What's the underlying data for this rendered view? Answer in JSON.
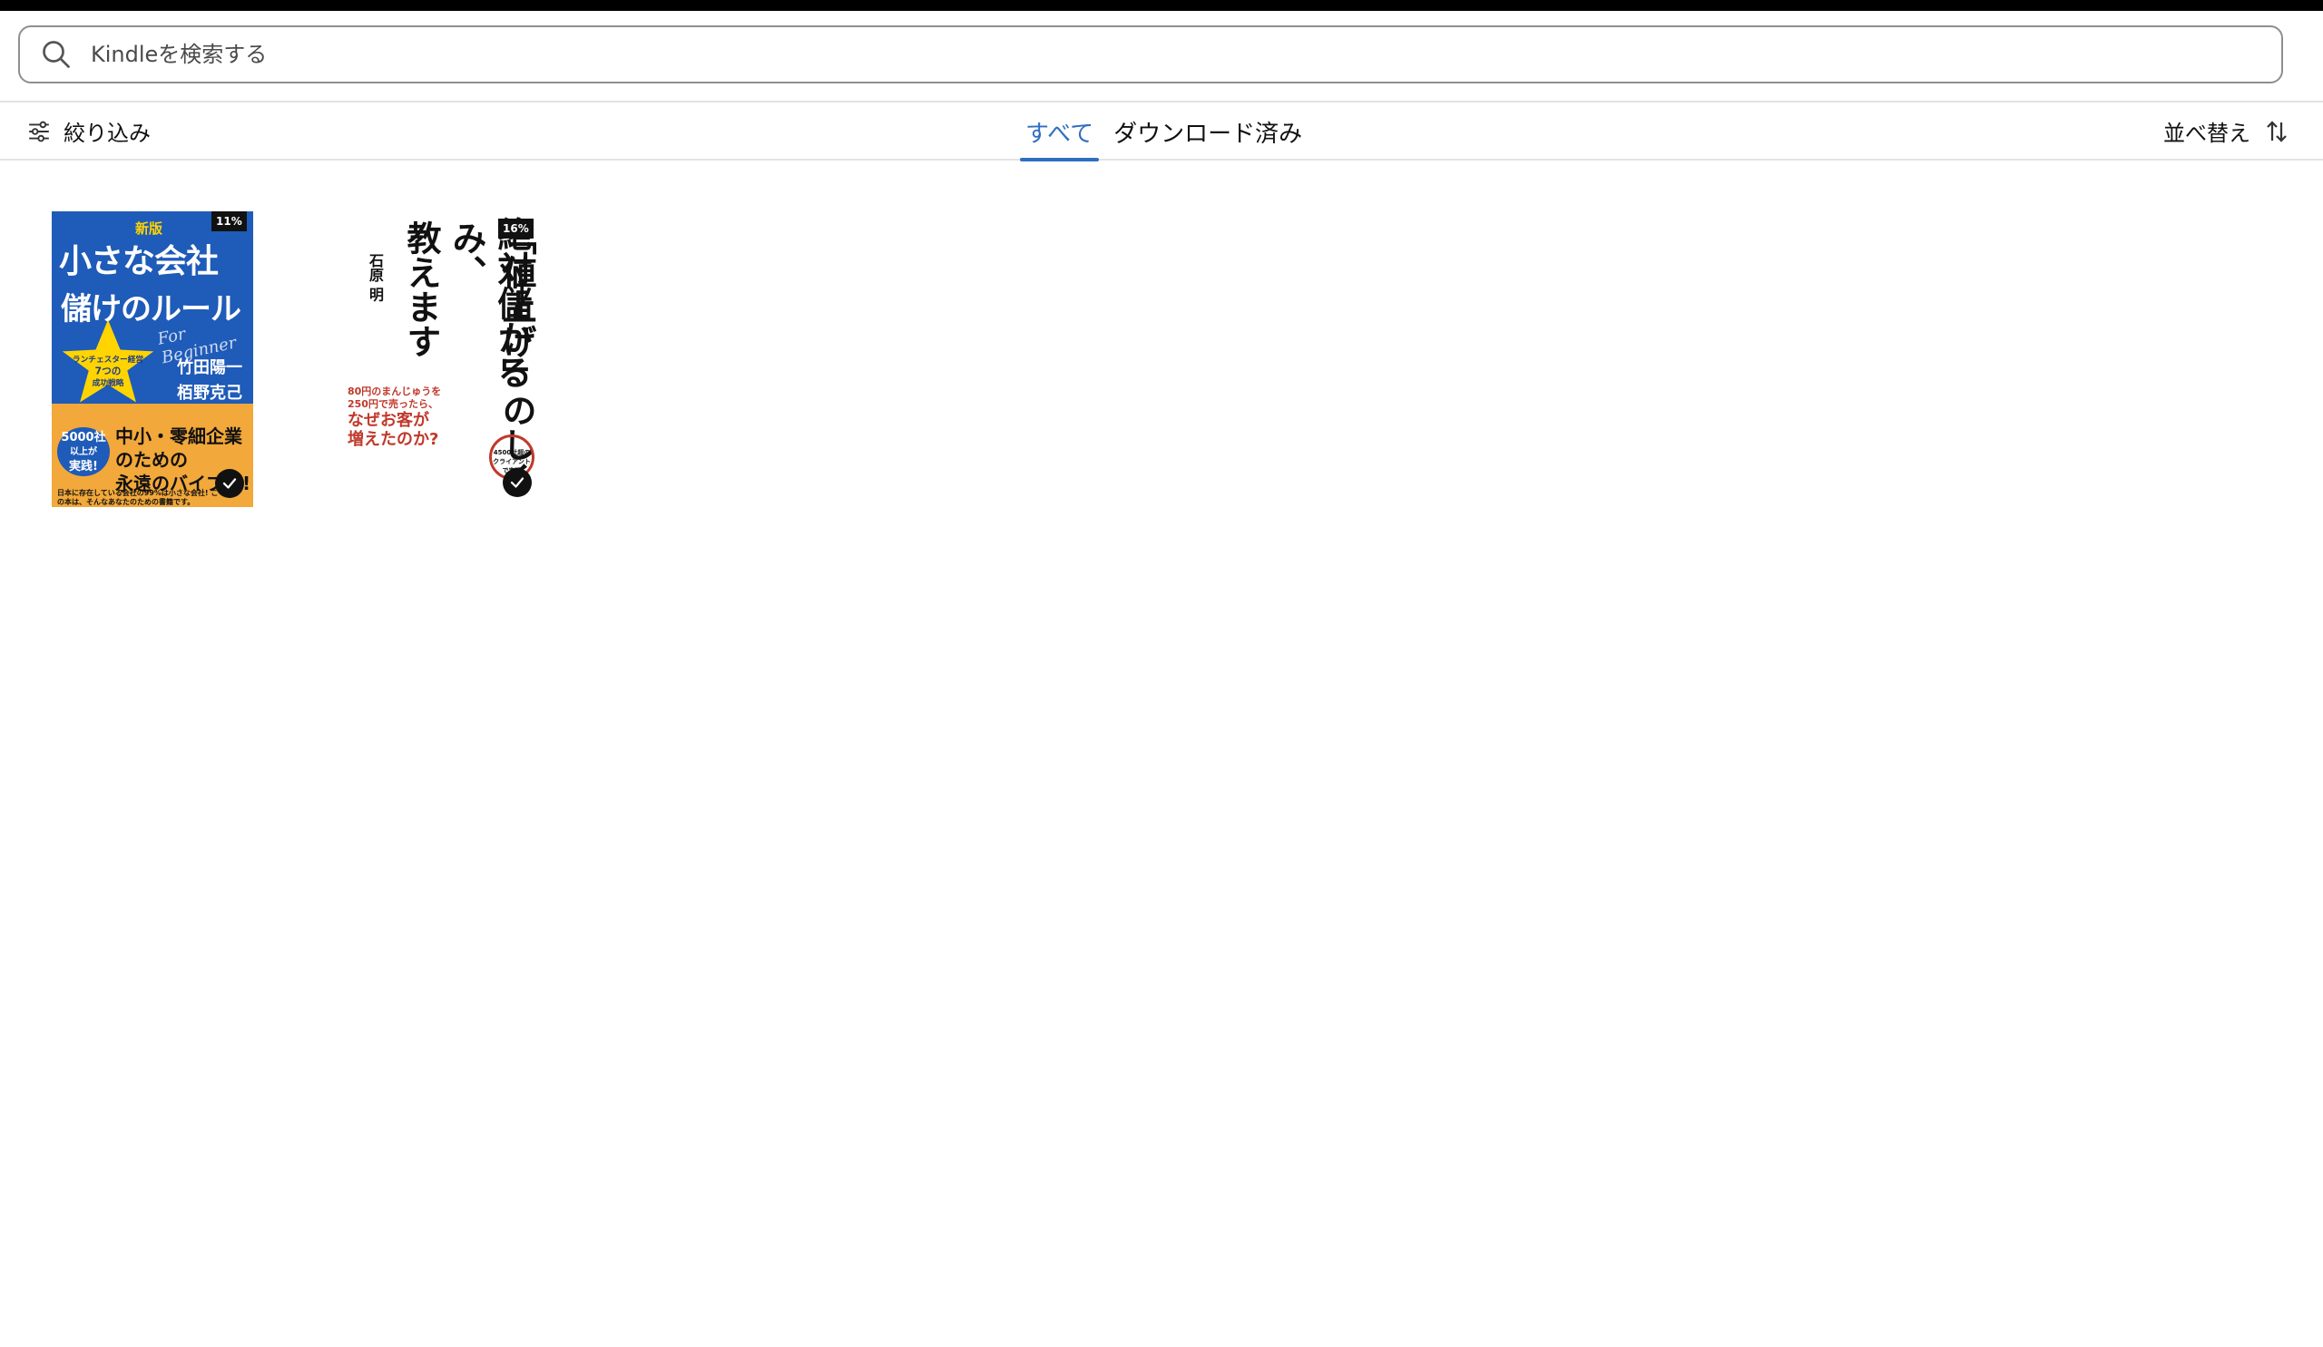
{
  "search": {
    "placeholder": "Kindleを検索する",
    "icon": "search-icon"
  },
  "toolbar": {
    "filter_label": "絞り込み",
    "tabs": [
      {
        "label": "すべて",
        "active": true
      },
      {
        "label": "ダウンロード済み",
        "active": false
      }
    ],
    "sort_label": "並べ替え",
    "accent_color": "#2f6fbf"
  },
  "books": [
    {
      "progress_label": "11%",
      "downloaded": true,
      "cover": {
        "edition": "新版",
        "title_line1": "小さな会社",
        "title_line2": "儲けのルール",
        "star_text_1": "ランチェスター経営",
        "star_text_2": "7つの",
        "star_text_3": "成功戦略",
        "for_beginner": "For Beginner",
        "author1": "竹田陽一",
        "author2": "栢野克己",
        "circle_text_1": "5000社",
        "circle_text_2": "以上が",
        "circle_text_3": "実践!",
        "subtitle_1": "中小・零細企業",
        "subtitle_2": "のための",
        "subtitle_3": "永遠のバイブル!",
        "footer": "日本に存在している会社の99%は小さな会社! この本は、そんなあなたのための書籍です。"
      }
    },
    {
      "progress_label": "16%",
      "downloaded": true,
      "cover": {
        "title_col1": "絶対儲かる",
        "title_col2": "「値上げ」のしくみ、",
        "title_col3": "教えます",
        "author": "石原 明",
        "sub_line1": "80円のまんじゅうを",
        "sub_line2": "250円で売ったら、",
        "sub_line3": "なぜお客が",
        "sub_line4": "増えたのか?",
        "ring_text": "4500社超のクライアントで実証"
      }
    }
  ]
}
